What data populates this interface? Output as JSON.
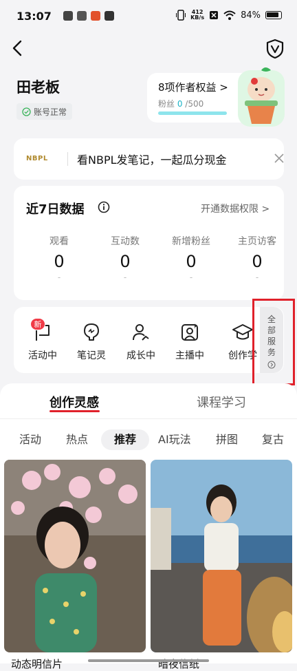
{
  "status_bar": {
    "time": "13:07",
    "speed_value": "412",
    "speed_unit": "KB/s",
    "battery": "84%"
  },
  "profile": {
    "name": "田老板",
    "account_status": "账号正常"
  },
  "rights": {
    "title": "8项作者权益 >",
    "fans_label": "粉丝",
    "fans_current": "0",
    "fans_target": " /500",
    "progress": 0
  },
  "banner": {
    "logo": "NBPL",
    "text": "看NBPL发笔记，一起瓜分现金"
  },
  "stats": {
    "title": "近7日数据",
    "permission_link": "开通数据权限 >",
    "items": [
      {
        "label": "观看",
        "value": "0",
        "delta": "-"
      },
      {
        "label": "互动数",
        "value": "0",
        "delta": "-"
      },
      {
        "label": "新增粉丝",
        "value": "0",
        "delta": "-"
      },
      {
        "label": "主页访客",
        "value": "0",
        "delta": "-"
      }
    ]
  },
  "services": {
    "items": [
      {
        "label": "活动中",
        "icon": "flag-icon"
      },
      {
        "label": "笔记灵",
        "icon": "lightbulb-icon"
      },
      {
        "label": "成长中",
        "icon": "user-growth-icon"
      },
      {
        "label": "主播中",
        "icon": "live-portrait-icon"
      },
      {
        "label": "创作学",
        "icon": "graduation-cap-icon"
      }
    ],
    "new_badge": "新",
    "all_services": "全部服务"
  },
  "tabs": {
    "active": "创作灵感",
    "inactive": "课程学习"
  },
  "chips": [
    "活动",
    "热点",
    "推荐",
    "AI玩法",
    "拼图",
    "复古"
  ],
  "feed": {
    "captions": [
      "动态明信片",
      "暗夜信纸"
    ]
  },
  "colors": {
    "accent": "#e0212b",
    "teal": "#19b3c6"
  }
}
